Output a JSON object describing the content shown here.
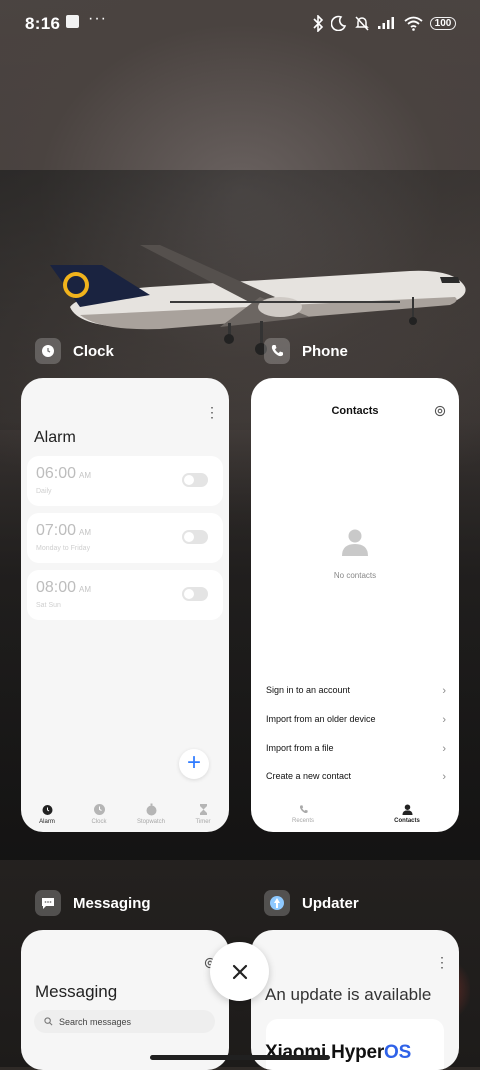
{
  "status_bar": {
    "time": "8:16",
    "battery": "100"
  },
  "apps": {
    "clock": {
      "name": "Clock",
      "title": "Alarm",
      "alarms": [
        {
          "time": "06:00",
          "ampm": "AM",
          "repeat": "Daily"
        },
        {
          "time": "07:00",
          "ampm": "AM",
          "repeat": "Monday to Friday"
        },
        {
          "time": "08:00",
          "ampm": "AM",
          "repeat": "Sat Sun"
        }
      ],
      "fab_label": "+",
      "tabs": [
        "Alarm",
        "Clock",
        "Stopwatch",
        "Timer"
      ],
      "active_tab": "Alarm"
    },
    "phone": {
      "name": "Phone",
      "title": "Contacts",
      "empty_text": "No contacts",
      "options": [
        "Sign in to an account",
        "Import from an older device",
        "Import from a file",
        "Create a new contact"
      ],
      "tabs": [
        "Recents",
        "Contacts"
      ],
      "active_tab": "Contacts"
    },
    "messaging": {
      "name": "Messaging",
      "title": "Messaging",
      "search_placeholder": "Search messages"
    },
    "updater": {
      "name": "Updater",
      "title": "An update is available",
      "brand_prefix": "Xiaomi Hyper",
      "brand_suffix": "OS"
    }
  },
  "colors": {
    "accent": "#2f7bff",
    "hyperos_blue": "#2f62e8",
    "card_bg": "#f6f6f6"
  },
  "close_label": "×"
}
